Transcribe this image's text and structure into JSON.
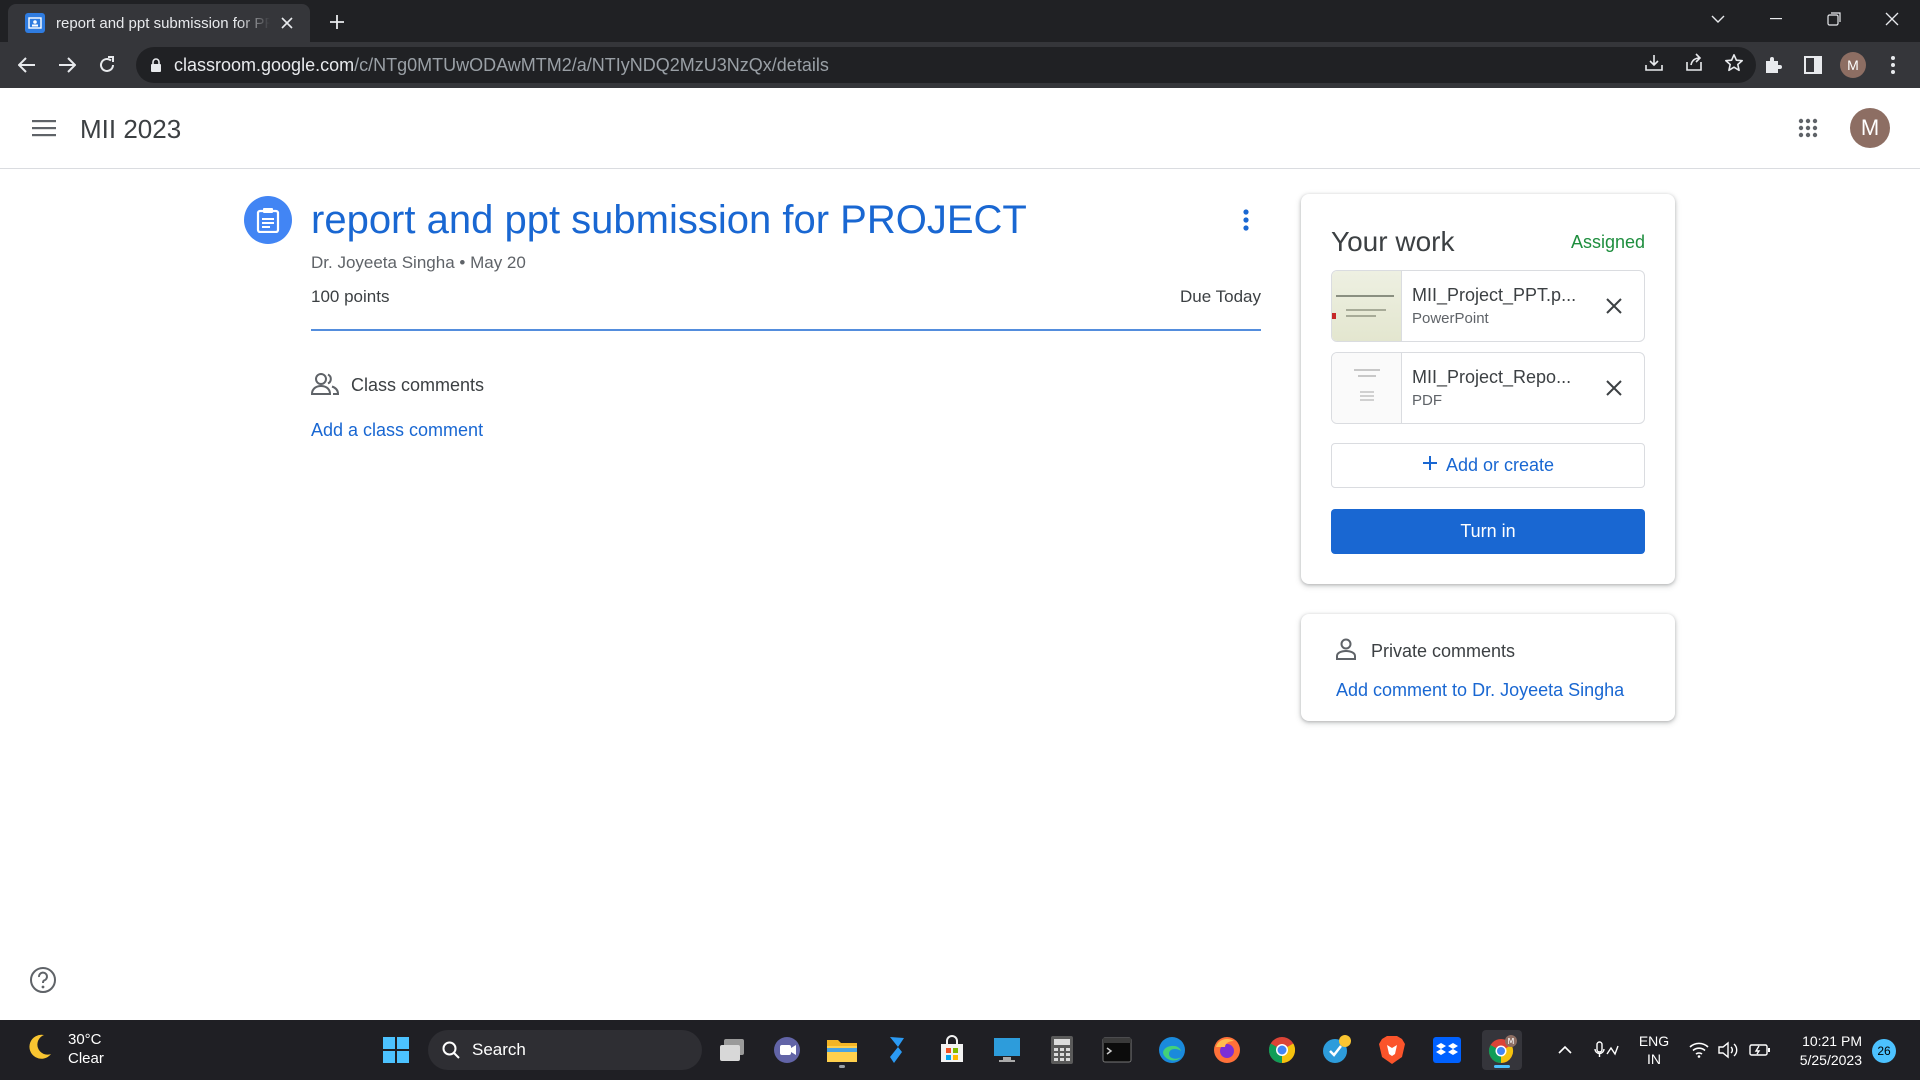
{
  "browser": {
    "tab_title": "report and ppt submission for PROJECT",
    "url_host": "classroom.google.com",
    "url_path": "/c/NTg0MTUwODAwMTM2/a/NTIyNDQ2MzU3NzQx/details",
    "profile_initial": "M"
  },
  "app": {
    "class_name": "MII 2023",
    "avatar_initial": "M"
  },
  "assignment": {
    "title": "report and ppt submission for PROJECT",
    "author": "Dr. Joyeeta Singha",
    "separator": "•",
    "date": "May 20",
    "points": "100 points",
    "due": "Due Today"
  },
  "class_comments": {
    "label": "Class comments",
    "add_label": "Add a class comment"
  },
  "your_work": {
    "title": "Your work",
    "status": "Assigned",
    "status_color": "#1e8e3e",
    "attachments": [
      {
        "name": "MII_Project_PPT.p...",
        "type": "PowerPoint"
      },
      {
        "name": "MII_Project_Repo...",
        "type": "PDF"
      }
    ],
    "add_label": "Add or create",
    "turn_in_label": "Turn in"
  },
  "private_comments": {
    "label": "Private comments",
    "add_label": "Add comment to Dr. Joyeeta Singha"
  },
  "taskbar": {
    "temperature": "30°C",
    "condition": "Clear",
    "search_label": "Search",
    "lang_line1": "ENG",
    "lang_line2": "IN",
    "time": "10:21 PM",
    "date": "5/25/2023",
    "notification_count": "26"
  },
  "colors": {
    "accent": "#1967d2",
    "classroom_icon": "#4285f4",
    "avatar": "#8d6e63"
  }
}
